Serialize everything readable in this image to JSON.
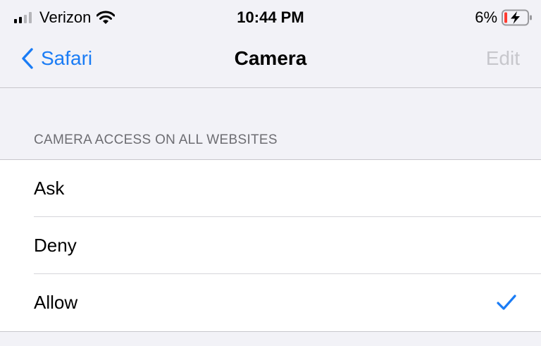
{
  "status_bar": {
    "carrier": "Verizon",
    "time": "10:44 PM",
    "battery_percent": "6%",
    "signal_bars_total": 4,
    "signal_bars_active": 2
  },
  "nav": {
    "back_label": "Safari",
    "title": "Camera",
    "edit_label": "Edit"
  },
  "section": {
    "header": "CAMERA ACCESS ON ALL WEBSITES",
    "options": [
      {
        "label": "Ask",
        "selected": false
      },
      {
        "label": "Deny",
        "selected": false
      },
      {
        "label": "Allow",
        "selected": true
      }
    ]
  },
  "colors": {
    "accent": "#1a7cf5",
    "background": "#f2f2f7",
    "disabled_text": "#c7c7cc",
    "section_header_text": "#6d6d72",
    "battery_low": "#ff3b30"
  },
  "icons": {
    "back": "chevron-left-icon",
    "wifi": "wifi-icon",
    "battery": "battery-charging-icon",
    "selected": "checkmark-icon"
  }
}
